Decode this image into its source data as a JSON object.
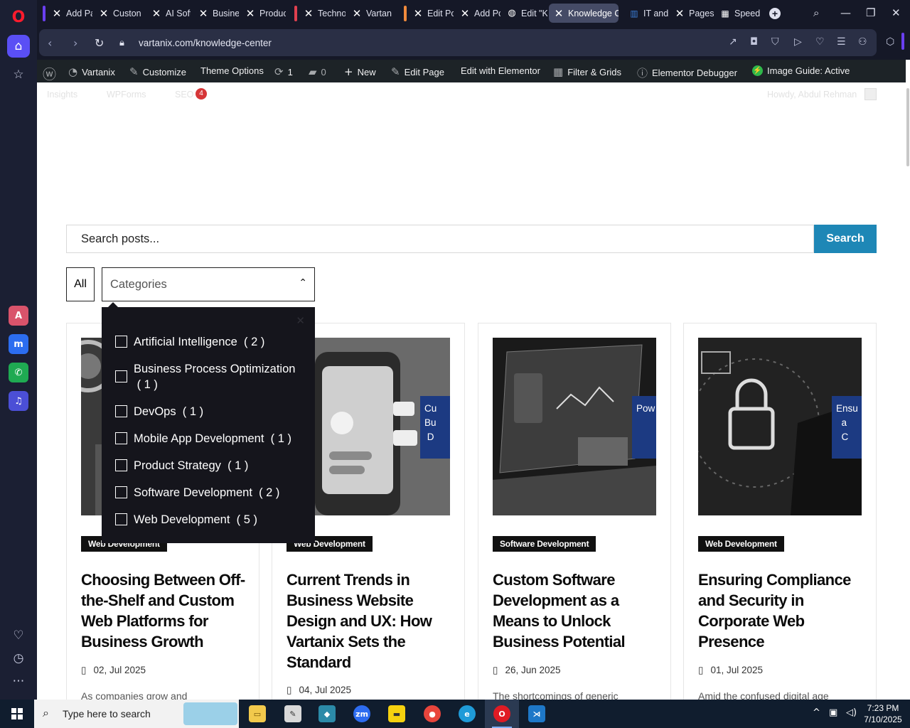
{
  "browser": {
    "tabs": [
      {
        "label": "Add Pa",
        "icon": "elementor-icon"
      },
      {
        "label": "Custon",
        "icon": "elementor-icon"
      },
      {
        "label": "AI Soft",
        "icon": "elementor-icon"
      },
      {
        "label": "Busine",
        "icon": "elementor-icon"
      },
      {
        "label": "Produc",
        "icon": "elementor-icon"
      },
      {
        "label": "Techno",
        "icon": "elementor-icon"
      },
      {
        "label": "Vartan",
        "icon": "elementor-icon"
      },
      {
        "label": "Edit Po",
        "icon": "elementor-icon"
      },
      {
        "label": "Add Po",
        "icon": "elementor-icon"
      },
      {
        "label": "Edit \"K",
        "icon": "wordpress-icon"
      },
      {
        "label": "Knowledge C",
        "icon": "elementor-icon"
      },
      {
        "label": "IT and",
        "icon": "book-icon"
      },
      {
        "label": "Pages",
        "icon": "elementor-icon"
      },
      {
        "label": "Speed",
        "icon": "grid-icon"
      }
    ],
    "url": "vartanix.com/knowledge-center"
  },
  "wp_admin_bar": {
    "site": "Vartanix",
    "customize": "Customize",
    "theme_options": "Theme Options",
    "updates_count": "1",
    "comments_count": "0",
    "new": "New",
    "edit_page": "Edit Page",
    "edit_elementor": "Edit with Elementor",
    "filter_grids": "Filter & Grids",
    "debugger": "Elementor Debugger",
    "image_guide": "Image Guide: Active"
  },
  "ghost_bar": {
    "insights": "Insights",
    "wpforms": "WPForms",
    "seo": "SEO",
    "seo_count": "4",
    "howdy": "Howdy, Abdul Rehman"
  },
  "search": {
    "placeholder": "Search posts...",
    "button": "Search"
  },
  "filters": {
    "all": "All",
    "categories_label": "Categories",
    "options": [
      {
        "name": "Artificial Intelligence",
        "count": "( 2 )"
      },
      {
        "name": "Business Process Optimization",
        "count": "( 1 )"
      },
      {
        "name": "DevOps",
        "count": "( 1 )"
      },
      {
        "name": "Mobile App Development",
        "count": "( 1 )"
      },
      {
        "name": "Product Strategy",
        "count": "( 1 )"
      },
      {
        "name": "Software Development",
        "count": "( 2 )"
      },
      {
        "name": "Web Development",
        "count": "( 5 )"
      }
    ]
  },
  "posts": [
    {
      "category": "Web Development",
      "title": "Choosing Between Off-the-Shelf and Custom Web Platforms for Business Growth",
      "date": "02, Jul 2025",
      "excerpt": "As companies grow and",
      "overlay": ""
    },
    {
      "category": "Web Development",
      "title": "Current Trends in Business Website Design and UX: How Vartanix Sets the Standard",
      "date": "04, Jul 2025",
      "excerpt": "",
      "overlay": "Cu\nBu\n D"
    },
    {
      "category": "Software Development",
      "title": "Custom Software Development as a Means to Unlock Business Potential",
      "date": "26, Jun 2025",
      "excerpt": "The shortcomings of generic",
      "overlay": "Pow\nwith\nSoft"
    },
    {
      "category": "Web Development",
      "title": "Ensuring Compliance and Security in Corporate Web Presence",
      "date": "01, Jul 2025",
      "excerpt": "Amid the confused digital age",
      "overlay": "Ensu\n  a\n  C"
    }
  ],
  "taskbar": {
    "search_placeholder": "Type here to search",
    "time": "7:23 PM",
    "date": "7/10/2025"
  },
  "colors": {
    "accent": "#1e87b6",
    "wp_bar": "#1d2327",
    "dropdown_bg": "#15151c",
    "category_badge": "#111111"
  }
}
